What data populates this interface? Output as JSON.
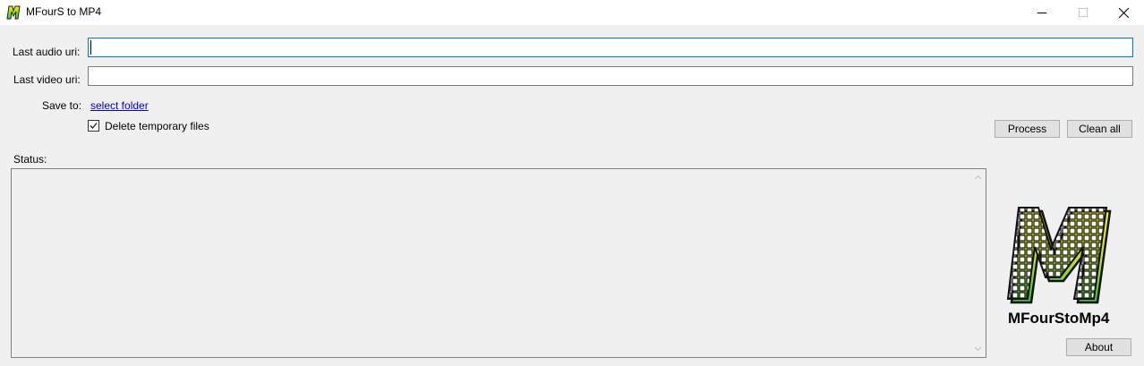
{
  "window": {
    "title": "MFourS to MP4",
    "icon": "mfours-app-icon"
  },
  "form": {
    "audio_label": "Last audio uri:",
    "audio_value": "",
    "video_label": "Last video uri:",
    "video_value": "",
    "save_label": "Save to:",
    "save_link": "select folder",
    "delete_temp_label": "Delete temporary files",
    "delete_temp_checked": true
  },
  "buttons": {
    "process": "Process",
    "clean_all": "Clean all",
    "about": "About"
  },
  "status": {
    "label": "Status:",
    "text": ""
  },
  "branding": {
    "logo_text": "MFourStoMp4"
  },
  "colors": {
    "accent": "#0078d7",
    "link": "#0000ee",
    "logo_yellow": "#f0f000",
    "logo_green": "#3cc83c"
  }
}
